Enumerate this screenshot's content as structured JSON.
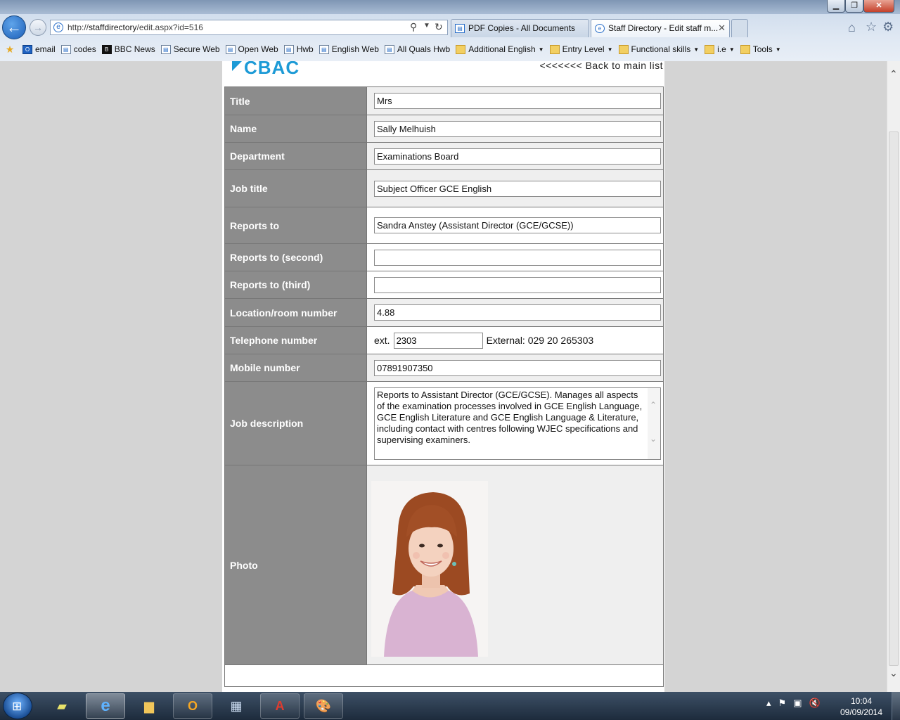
{
  "browser": {
    "address_bar": {
      "url_prefix": "http://",
      "url_host": "staffdirectory",
      "url_path": "/edit.aspx?id=516"
    },
    "tabs": [
      {
        "label": "PDF Copies - All Documents"
      },
      {
        "label": "Staff Directory - Edit staff m..."
      }
    ],
    "favorites": [
      {
        "label": "email",
        "icon": "outlook-icon"
      },
      {
        "label": "codes",
        "icon": "webpage-icon"
      },
      {
        "label": "BBC News",
        "icon": "bbc-icon"
      },
      {
        "label": "Secure Web",
        "icon": "webpage-icon"
      },
      {
        "label": "Open Web",
        "icon": "webpage-icon"
      },
      {
        "label": "Hwb",
        "icon": "webpage-icon"
      },
      {
        "label": "English Web",
        "icon": "webpage-icon"
      },
      {
        "label": "All Quals Hwb",
        "icon": "webpage-icon"
      },
      {
        "label": "Additional English",
        "icon": "folder-icon",
        "dropdown": true
      },
      {
        "label": "Entry Level",
        "icon": "folder-icon",
        "dropdown": true
      },
      {
        "label": "Functional skills",
        "icon": "folder-icon",
        "dropdown": true
      },
      {
        "label": "i.e",
        "icon": "folder-icon",
        "dropdown": true
      },
      {
        "label": "Tools",
        "icon": "folder-icon",
        "dropdown": true
      }
    ]
  },
  "page": {
    "logo_text": "CBAC",
    "back_link": "<<<<<<< Back to main list",
    "fields": {
      "title": {
        "label": "Title",
        "value": "Mrs"
      },
      "name": {
        "label": "Name",
        "value": "Sally Melhuish"
      },
      "department": {
        "label": "Department",
        "value": "Examinations Board"
      },
      "job_title": {
        "label": "Job title",
        "value": "Subject Officer GCE English"
      },
      "reports_to": {
        "label": "Reports to",
        "value": "Sandra Anstey (Assistant Director (GCE/GCSE))"
      },
      "reports_to_2": {
        "label": "Reports to (second)",
        "value": ""
      },
      "reports_to_3": {
        "label": "Reports to (third)",
        "value": ""
      },
      "location": {
        "label": "Location/room number",
        "value": "4.88"
      },
      "telephone": {
        "label": "Telephone number",
        "ext_prefix": "ext.",
        "ext_value": "2303",
        "external": "External: 029 20 265303"
      },
      "mobile": {
        "label": "Mobile number",
        "value": "07891907350"
      },
      "job_description": {
        "label": "Job description",
        "value": "Reports to Assistant Director (GCE/GCSE).  Manages all aspects of the examination processes involved in GCE English Language, GCE English Literature and GCE English Language & Literature, including contact with centres following WJEC specifications and supervising examiners."
      },
      "photo": {
        "label": "Photo"
      }
    }
  },
  "taskbar": {
    "apps": [
      "start-button",
      "explorer-sticky-notes",
      "internet-explorer",
      "file-explorer",
      "outlook",
      "calculator",
      "adobe-reader",
      "paint"
    ],
    "clock_time": "10:04",
    "clock_date": "09/09/2014"
  },
  "colors": {
    "label_bg": "#8c8c8c",
    "value_bg": "#efefef",
    "logo": "#1c9ad6",
    "page_bg": "#d4d4d4"
  }
}
